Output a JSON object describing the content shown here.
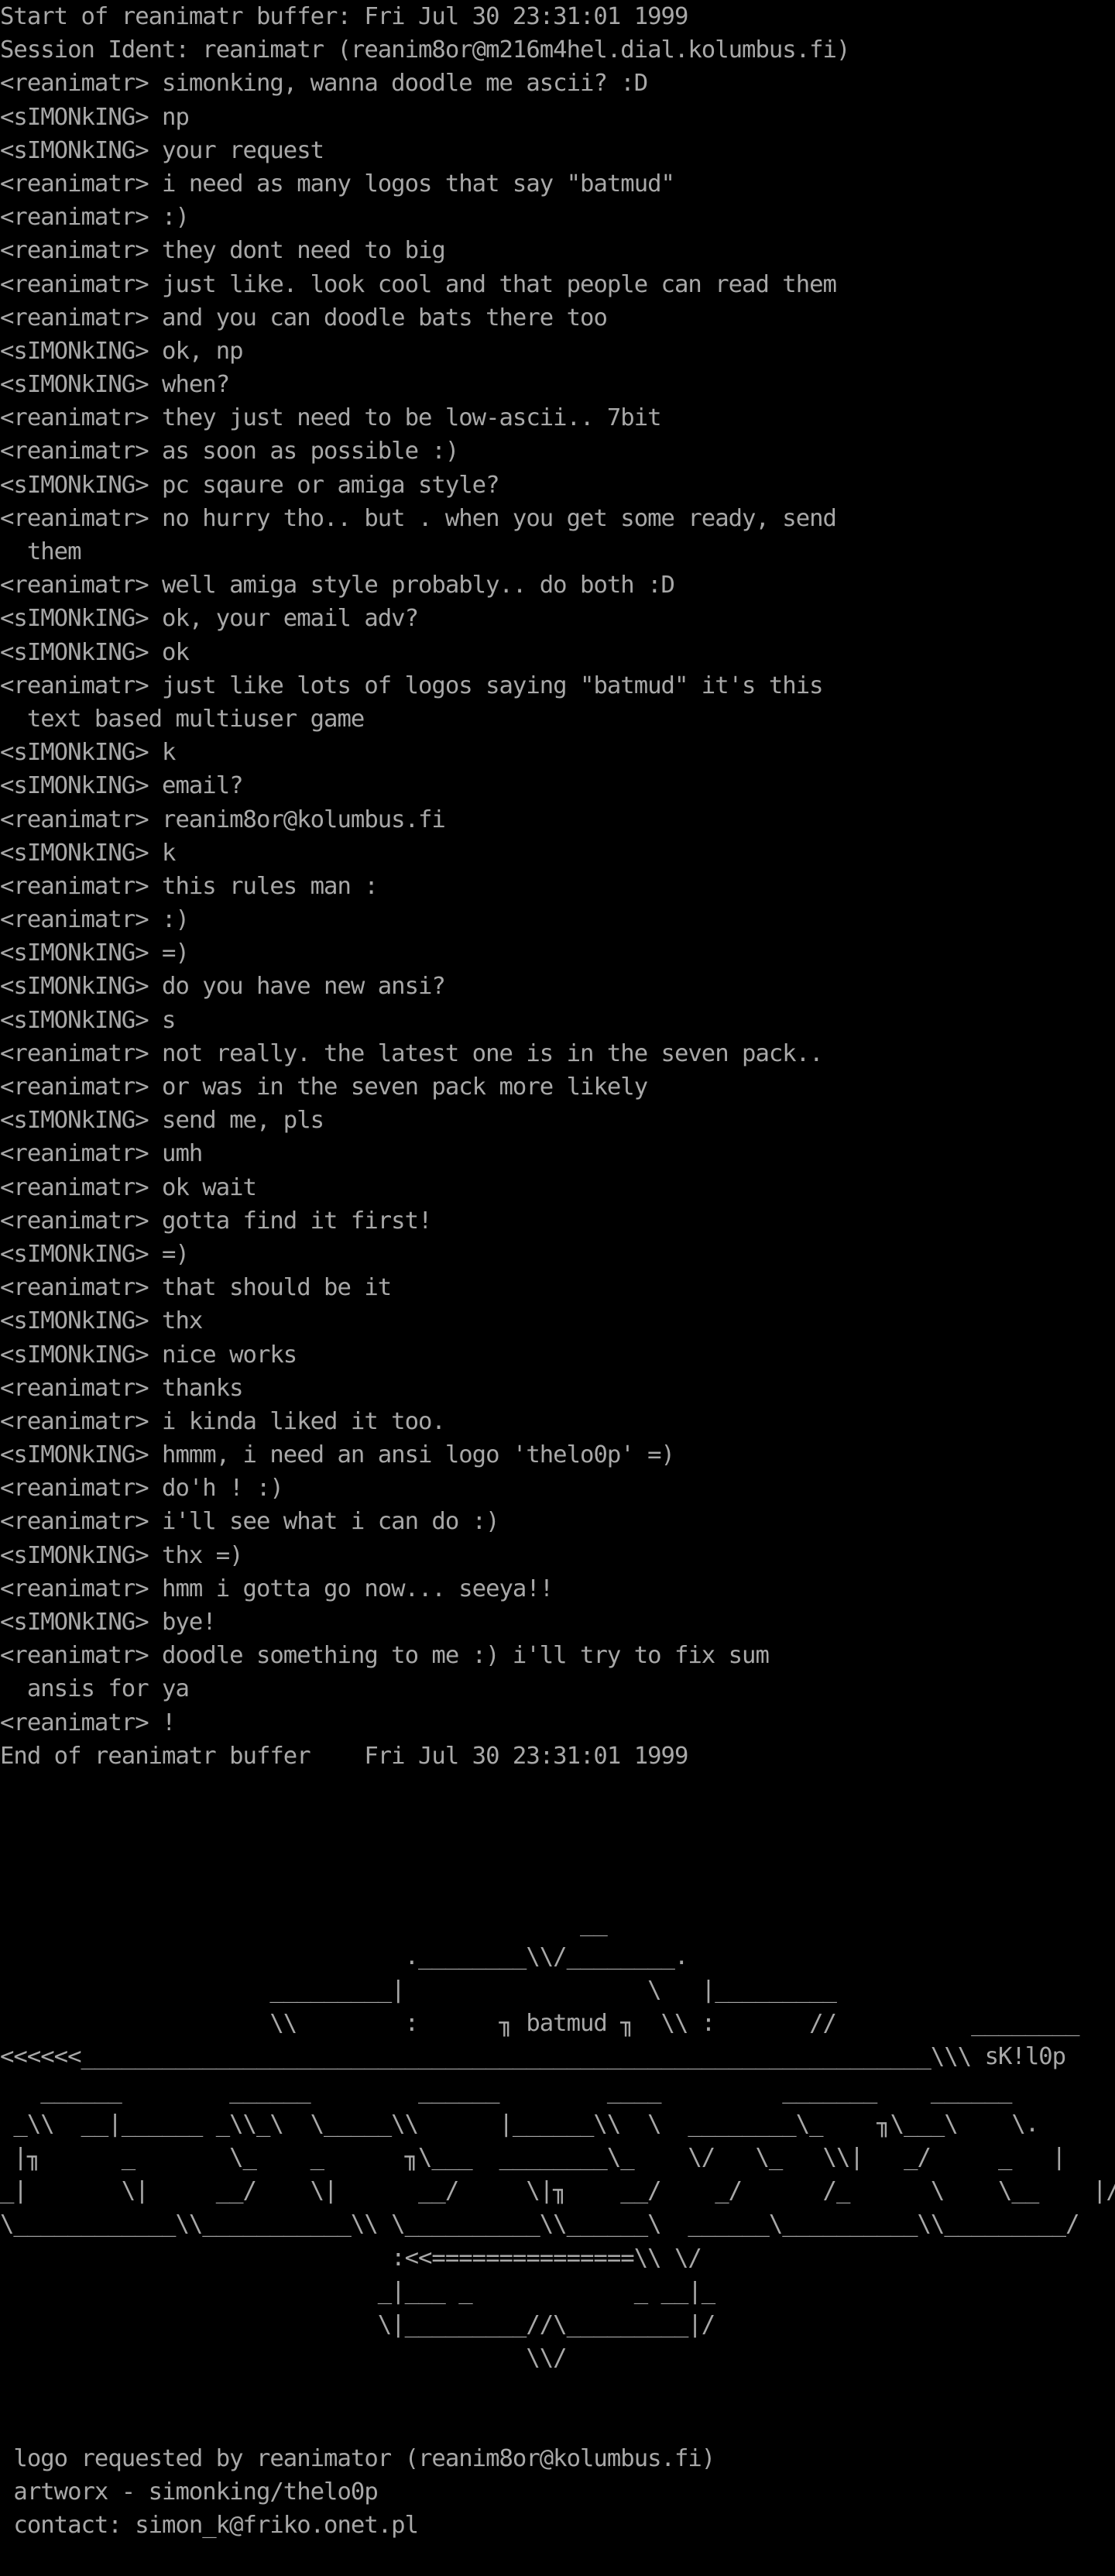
{
  "colors": {
    "background": "#000000",
    "text": "#a8a8a8"
  },
  "log": {
    "start_line": "Start of reanimatr buffer: Fri Jul 30 23:31:01 1999",
    "session_line": "Session Ident: reanimatr (reanim8or@m216m4hel.dial.kolumbus.fi)",
    "messages": [
      {
        "nick": "<reanimatr>",
        "text": "simonking, wanna doodle me ascii? :D"
      },
      {
        "nick": "<sIMONkING>",
        "text": "np"
      },
      {
        "nick": "<sIMONkING>",
        "text": "your request"
      },
      {
        "nick": "<reanimatr>",
        "text": "i need as many logos that say \"batmud\""
      },
      {
        "nick": "<reanimatr>",
        "text": ":)"
      },
      {
        "nick": "<reanimatr>",
        "text": "they dont need to big"
      },
      {
        "nick": "<reanimatr>",
        "text": "just like. look cool and that people can read them"
      },
      {
        "nick": "<reanimatr>",
        "text": "and you can doodle bats there too"
      },
      {
        "nick": "<sIMONkING>",
        "text": "ok, np"
      },
      {
        "nick": "<sIMONkING>",
        "text": "when?"
      },
      {
        "nick": "<reanimatr>",
        "text": "they just need to be low-ascii.. 7bit"
      },
      {
        "nick": "<reanimatr>",
        "text": "as soon as possible :)"
      },
      {
        "nick": "<sIMONkING>",
        "text": "pc sqaure or amiga style?"
      },
      {
        "nick": "<reanimatr>",
        "text": "no hurry tho.. but . when you get some ready, send",
        "cont": "  them"
      },
      {
        "nick": "<reanimatr>",
        "text": "well amiga style probably.. do both :D"
      },
      {
        "nick": "<sIMONkING>",
        "text": "ok, your email adv?"
      },
      {
        "nick": "<sIMONkING>",
        "text": "ok"
      },
      {
        "nick": "<reanimatr>",
        "text": "just like lots of logos saying \"batmud\" it's this",
        "cont": "  text based multiuser game"
      },
      {
        "nick": "<sIMONkING>",
        "text": "k"
      },
      {
        "nick": "<sIMONkING>",
        "text": "email?"
      },
      {
        "nick": "<reanimatr>",
        "text": "reanim8or@kolumbus.fi"
      },
      {
        "nick": "<sIMONkING>",
        "text": "k"
      },
      {
        "nick": "<reanimatr>",
        "text": "this rules man :"
      },
      {
        "nick": "<reanimatr>",
        "text": ":)"
      },
      {
        "nick": "<sIMONkING>",
        "text": "=)"
      },
      {
        "nick": "<sIMONkING>",
        "text": "do you have new ansi?"
      },
      {
        "nick": "<sIMONkING>",
        "text": "s"
      },
      {
        "nick": "<reanimatr>",
        "text": "not really. the latest one is in the seven pack.."
      },
      {
        "nick": "<reanimatr>",
        "text": "or was in the seven pack more likely"
      },
      {
        "nick": "<sIMONkING>",
        "text": "send me, pls"
      },
      {
        "nick": "<reanimatr>",
        "text": "umh"
      },
      {
        "nick": "<reanimatr>",
        "text": "ok wait"
      },
      {
        "nick": "<reanimatr>",
        "text": "gotta find it first!"
      },
      {
        "nick": "<sIMONkING>",
        "text": "=)"
      },
      {
        "nick": "<reanimatr>",
        "text": "that should be it"
      },
      {
        "nick": "<sIMONkING>",
        "text": "thx"
      },
      {
        "nick": "<sIMONkING>",
        "text": "nice works"
      },
      {
        "nick": "<reanimatr>",
        "text": "thanks"
      },
      {
        "nick": "<reanimatr>",
        "text": "i kinda liked it too."
      },
      {
        "nick": "<sIMONkING>",
        "text": "hmmm, i need an ansi logo 'thelo0p' =)"
      },
      {
        "nick": "<reanimatr>",
        "text": "do'h ! :)"
      },
      {
        "nick": "<reanimatr>",
        "text": "i'll see what i can do :)"
      },
      {
        "nick": "<sIMONkING>",
        "text": "thx =)"
      },
      {
        "nick": "<reanimatr>",
        "text": "hmm i gotta go now... seeya!!"
      },
      {
        "nick": "<sIMONkING>",
        "text": "bye!"
      },
      {
        "nick": "<reanimatr>",
        "text": "doodle something to me :) i'll try to fix sum",
        "cont": "  ansis for ya"
      },
      {
        "nick": "<reanimatr>",
        "text": "!"
      }
    ],
    "end_line": "End of reanimatr buffer    Fri Jul 30 23:31:01 1999"
  },
  "logo": {
    "lines": [
      "                                           __",
      "                              .________\\\\/________.",
      "                    _________|                  \\   |_________",
      "                    \\\\        :      ╖ batmud ╖  \\\\ :       //          ________",
      "<<<<<<_______________________________________________________________\\\\\\ sK!l0p",
      "   ______        ______        ______        ____         _______    ______",
      " _\\\\  __|______ _\\\\_\\  \\_____\\\\      |______\\\\  \\  ________\\_    ╖\\___\\    \\.",
      " |╖      _       \\_    _      ╖\\___  ________\\_    \\/   \\_   \\\\|   _/     _   |",
      "_|       \\|     __/    \\|      __/     \\|╖    __/    _/      /_      \\    \\__    |/   |_",
      "\\____________\\\\___________\\\\ \\__________\\\\______\\  ______\\__________\\\\_________/",
      "                             :<<===============\\\\ \\/",
      "                            _|___ _            _ __|_",
      "                            \\|_________//\\_________|/",
      "                                       \\\\/"
    ]
  },
  "footer": {
    "request_line": " logo requested by reanimator (reanim8or@kolumbus.fi)",
    "artworx_line": " artworx - simonking/thelo0p",
    "contact_line": " contact: simon_k@friko.onet.pl"
  }
}
